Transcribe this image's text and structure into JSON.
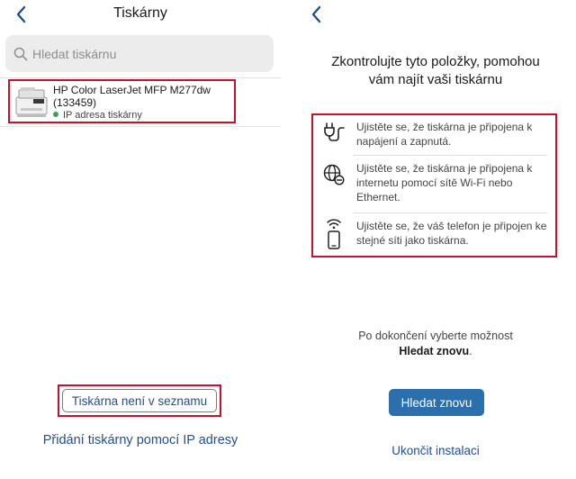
{
  "colors": {
    "accent": "#1f4f8f",
    "primary_button": "#2c6fad",
    "highlight_red": "#c8102e",
    "status_green": "#3fa34d"
  },
  "left": {
    "back_icon": "chevron-left-icon",
    "title": "Tiskárny",
    "search": {
      "icon": "search-icon",
      "placeholder": "Hledat tiskárnu",
      "value": ""
    },
    "printers": [
      {
        "name": "HP Color LaserJet MFP M277dw (133459)",
        "status": "IP adresa tiskárny",
        "status_color": "#3fa34d"
      }
    ],
    "not_listed_label": "Tiskárna není v seznamu",
    "add_by_ip_label": "Přidání tiskárny pomocí IP adresy"
  },
  "right": {
    "back_icon": "chevron-left-icon",
    "heading_line1": "Zkontrolujte tyto položky, pomohou",
    "heading_line2": "vám najít vaši tiskárnu",
    "checklist": [
      {
        "icon": "power-plug-icon",
        "text": "Ujistěte se, že tiskárna je připojena k napájení a zapnutá."
      },
      {
        "icon": "globe-network-icon",
        "text": "Ujistěte se, že tiskárna je připojena k internetu pomocí sítě Wi-Fi nebo Ethernet."
      },
      {
        "icon": "phone-wifi-icon",
        "text": "Ujistěte se, že váš telefon je připojen ke stejné síti jako tiskárna."
      }
    ],
    "hint_prefix": "Po dokončení vyberte možnost",
    "hint_bold": "Hledat znovu",
    "hint_suffix": ".",
    "search_again_label": "Hledat znovu",
    "exit_label": "Ukončit instalaci"
  }
}
